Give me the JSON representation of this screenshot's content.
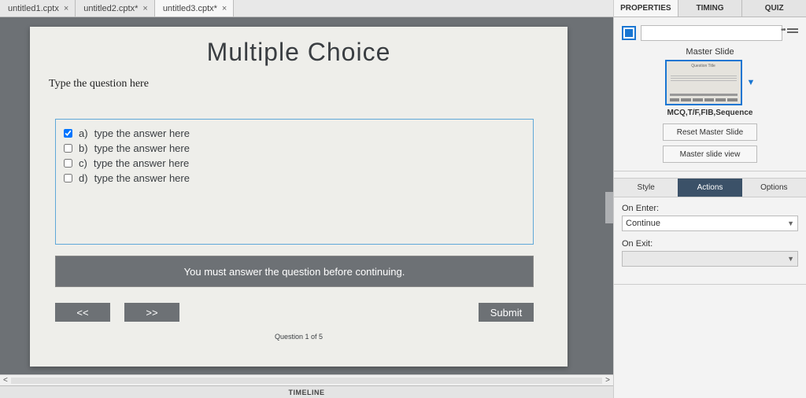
{
  "tabs": [
    {
      "label": "untitled1.cptx"
    },
    {
      "label": "untitled2.cptx*"
    },
    {
      "label": "untitled3.cptx*"
    }
  ],
  "slide": {
    "title": "Multiple Choice",
    "prompt": "Type the question here",
    "answers": [
      {
        "letter": "a)",
        "text": "type the answer here",
        "checked": true
      },
      {
        "letter": "b)",
        "text": "type the answer here",
        "checked": false
      },
      {
        "letter": "c)",
        "text": "type the answer here",
        "checked": false
      },
      {
        "letter": "d)",
        "text": "type the answer here",
        "checked": false
      }
    ],
    "message": "You must answer the question before continuing.",
    "prev": "<<",
    "next": ">>",
    "submit": "Submit",
    "counter": "Question 1 of 5"
  },
  "timeline_label": "TIMELINE",
  "right": {
    "tabs": {
      "properties": "PROPERTIES",
      "timing": "TIMING",
      "quiz": "QUIZ"
    },
    "master_label": "Master Slide",
    "master_thumb_title": "Question Title",
    "master_name": "MCQ,T/F,FIB,Sequence",
    "reset_btn": "Reset Master Slide",
    "view_btn": "Master slide view",
    "sub_tabs": {
      "style": "Style",
      "actions": "Actions",
      "options": "Options"
    },
    "on_enter_label": "On Enter:",
    "on_enter_value": "Continue",
    "on_exit_label": "On Exit:",
    "on_exit_value": ""
  }
}
